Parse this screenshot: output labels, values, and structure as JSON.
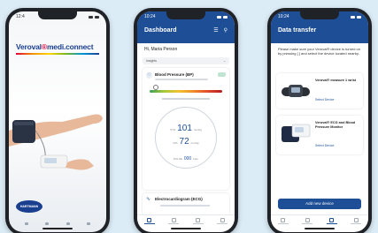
{
  "phone1": {
    "time": "12:4",
    "logo": {
      "part1": "Veroval",
      "part2": "®",
      "part3": "medi.connect"
    },
    "brand": "HARTMANN"
  },
  "dashboard": {
    "time": "10:24",
    "title": "Dashboard",
    "greeting": "Hi, Maria Person",
    "insights_label": "Insights",
    "bp_card": {
      "title": "Blood Pressure (BP)",
      "sys_label": "SYS",
      "sys_value": "101",
      "sys_unit": "mmHg",
      "dia_label": "DIA",
      "dia_value": "72",
      "dia_unit": "mmHg",
      "pulse_label": "PULSE",
      "pulse_value": "000",
      "pulse_unit": "bpm"
    },
    "ecg_title": "Electrocardiogram (ECG)"
  },
  "transfer": {
    "time": "10:24",
    "title": "Data transfer",
    "instructions": "Please make sure your Veroval® device is turned on by pressing [ ] and select the device located nearby.",
    "device1": {
      "name": "Veroval® measure 1 wrist",
      "action": "Select Device"
    },
    "device2": {
      "name": "Veroval® ECG and Blood Pressure Monitor",
      "action": "Select Device"
    },
    "add_button": "Add new device"
  },
  "colors": {
    "brand_blue": "#1d4e96",
    "brand_red": "#e2003a",
    "background": "#dcecf6"
  }
}
